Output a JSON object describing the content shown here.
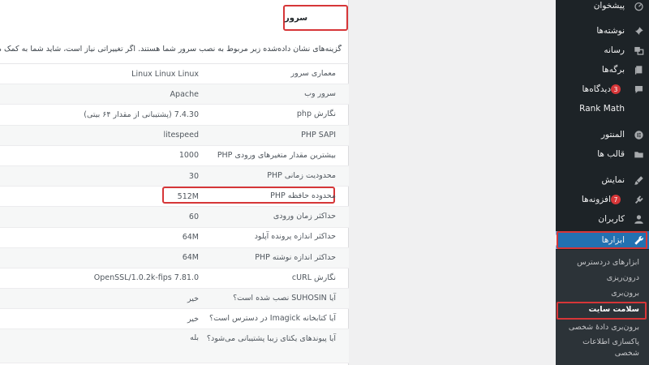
{
  "section_title": "سرور",
  "description": "گزینه‌های نشان داده‌شده زیر مربوط به نصب سرور شما هستند. اگر تغییراتی نیاز است، شاید شما به کمک می",
  "rows": [
    {
      "label": "معماری سرور",
      "value": "Linux Linux Linux"
    },
    {
      "label": "سرور وب",
      "value": "Apache"
    },
    {
      "label": "نگارش php",
      "value": "7.4.30 (پشتیبانی از مقدار ۶۴ بیتی)"
    },
    {
      "label": "PHP SAPI",
      "value": "litespeed"
    },
    {
      "label": "بیشترین مقدار متغیرهای ورودی PHP",
      "value": "1000"
    },
    {
      "label": "محدودیت زمانی PHP",
      "value": "30"
    },
    {
      "label": "محدوده حافظه PHP",
      "value": "512M"
    },
    {
      "label": "حداکثر زمان ورودی",
      "value": "60"
    },
    {
      "label": "حداکثر اندازه پرونده آپلود",
      "value": "64M"
    },
    {
      "label": "حداکثر اندازه نوشته PHP",
      "value": "64M"
    },
    {
      "label": "نگارش cURL",
      "value": "OpenSSL/1.0.2k-fips 7.81.0"
    },
    {
      "label": "آیا SUHOSIN نصب شده است؟",
      "value": "خیر"
    },
    {
      "label": "آیا کتابخانه Imagick در دسترس است؟",
      "value": "خیر"
    },
    {
      "label": "آیا پیوندهای یکتای زیبا پشتیبانی می‌شود؟",
      "value": "بله"
    }
  ],
  "sidebar": {
    "items": [
      {
        "label": "پیشخوان",
        "icon": "dashboard-icon"
      },
      {
        "label": "نوشته‌ها",
        "icon": "pin-icon"
      },
      {
        "label": "رسانه",
        "icon": "media-icon"
      },
      {
        "label": "برگه‌ها",
        "icon": "page-icon"
      },
      {
        "label": "دیدگاه‌ها",
        "icon": "comment-icon",
        "badge": "3"
      },
      {
        "label": "Rank Math",
        "icon": "rank-math-icon"
      },
      {
        "label": "المنتور",
        "icon": "elementor-icon"
      },
      {
        "label": "قالب ها",
        "icon": "folder-icon"
      },
      {
        "label": "نمایش",
        "icon": "brush-icon"
      },
      {
        "label": "افزونه‌ها",
        "icon": "plugin-icon",
        "badge": "7"
      },
      {
        "label": "کاربران",
        "icon": "users-icon"
      },
      {
        "label": "ابزارها",
        "icon": "wrench-icon",
        "active": true
      }
    ],
    "submenu": [
      {
        "label": "ابزارهای دردسترس"
      },
      {
        "label": "درون‌ریزی"
      },
      {
        "label": "برون‌بری"
      },
      {
        "label": "سلامت سایت",
        "current": true
      },
      {
        "label": "برون‌بری دادهٔ شخصی"
      },
      {
        "label": "پاکسازی اطلاعات شخصی"
      }
    ]
  },
  "colors": {
    "sidebar_bg": "#1d2327",
    "active_bg": "#2271b1",
    "highlight": "#d63638"
  }
}
